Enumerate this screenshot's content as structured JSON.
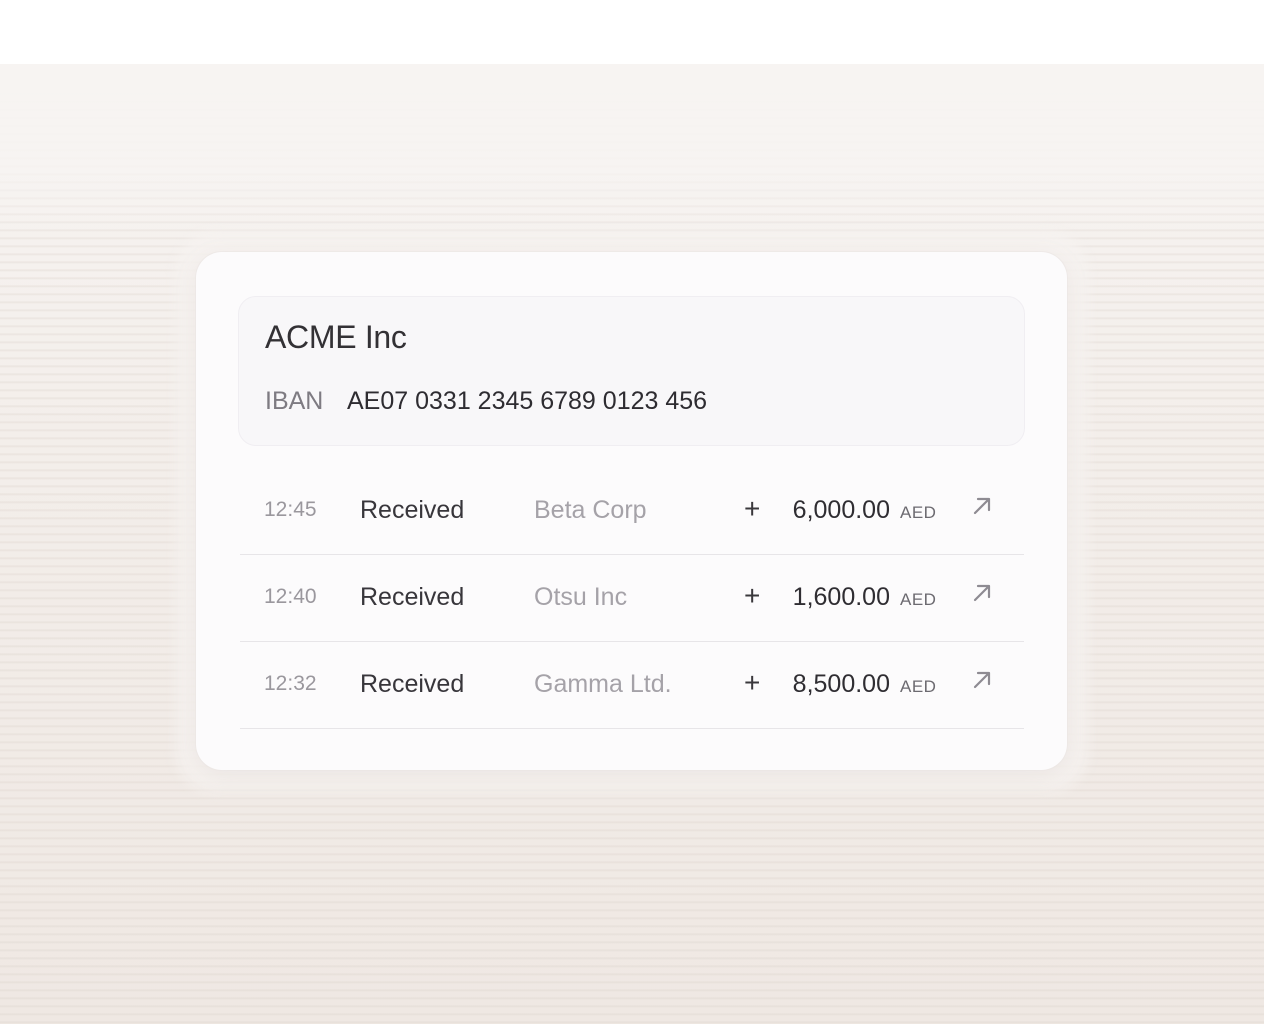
{
  "account": {
    "name": "ACME Inc",
    "iban_label": "IBAN",
    "iban_value": "AE07 0331 2345 6789 0123 456"
  },
  "transactions": [
    {
      "time": "12:45",
      "status": "Received",
      "party": "Beta Corp",
      "sign": "+",
      "amount": "6,000.00",
      "currency": "AED",
      "icon": "arrow-up-right-icon"
    },
    {
      "time": "12:40",
      "status": "Received",
      "party": "Otsu Inc",
      "sign": "+",
      "amount": "1,600.00",
      "currency": "AED",
      "icon": "arrow-up-right-icon"
    },
    {
      "time": "12:32",
      "status": "Received",
      "party": "Gamma Ltd.",
      "sign": "+",
      "amount": "8,500.00",
      "currency": "AED",
      "icon": "arrow-up-right-icon"
    }
  ],
  "colors": {
    "background": "#f3eeea",
    "card": "#fcfbfc",
    "panel": "#f8f7f9",
    "text_primary": "#2f2d32",
    "text_muted": "#a5a2a8"
  }
}
